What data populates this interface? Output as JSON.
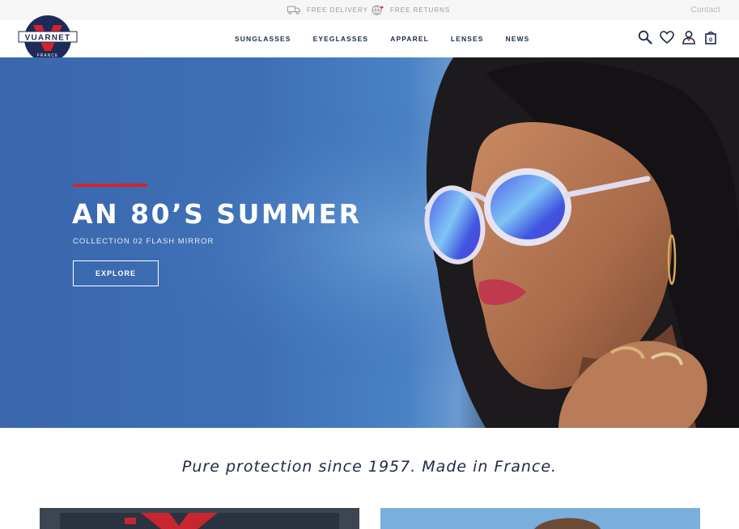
{
  "topbar": {
    "delivery_label": "FREE DELIVERY",
    "returns_label": "FREE RETURNS",
    "contact_label": "Contact"
  },
  "brand": {
    "name": "VUARNET",
    "tagline_small": "FRANCE",
    "colors": {
      "navy": "#1b2a4a",
      "red": "#d2232e",
      "logo_navy": "#1e2a57"
    }
  },
  "nav": {
    "items": [
      {
        "label": "SUNGLASSES"
      },
      {
        "label": "EYEGLASSES"
      },
      {
        "label": "APPAREL"
      },
      {
        "label": "LENSES"
      },
      {
        "label": "NEWS"
      }
    ]
  },
  "header_icons": [
    "search-icon",
    "heart-icon",
    "user-icon",
    "cart-icon"
  ],
  "cart": {
    "count": "0"
  },
  "hero": {
    "title": "AN 80’S SUMMER",
    "subtitle": "COLLECTION 02 FLASH MIRROR",
    "cta_label": "EXPLORE",
    "accent_color": "#d2232e"
  },
  "tagline": "Pure protection since 1957. Made in France."
}
